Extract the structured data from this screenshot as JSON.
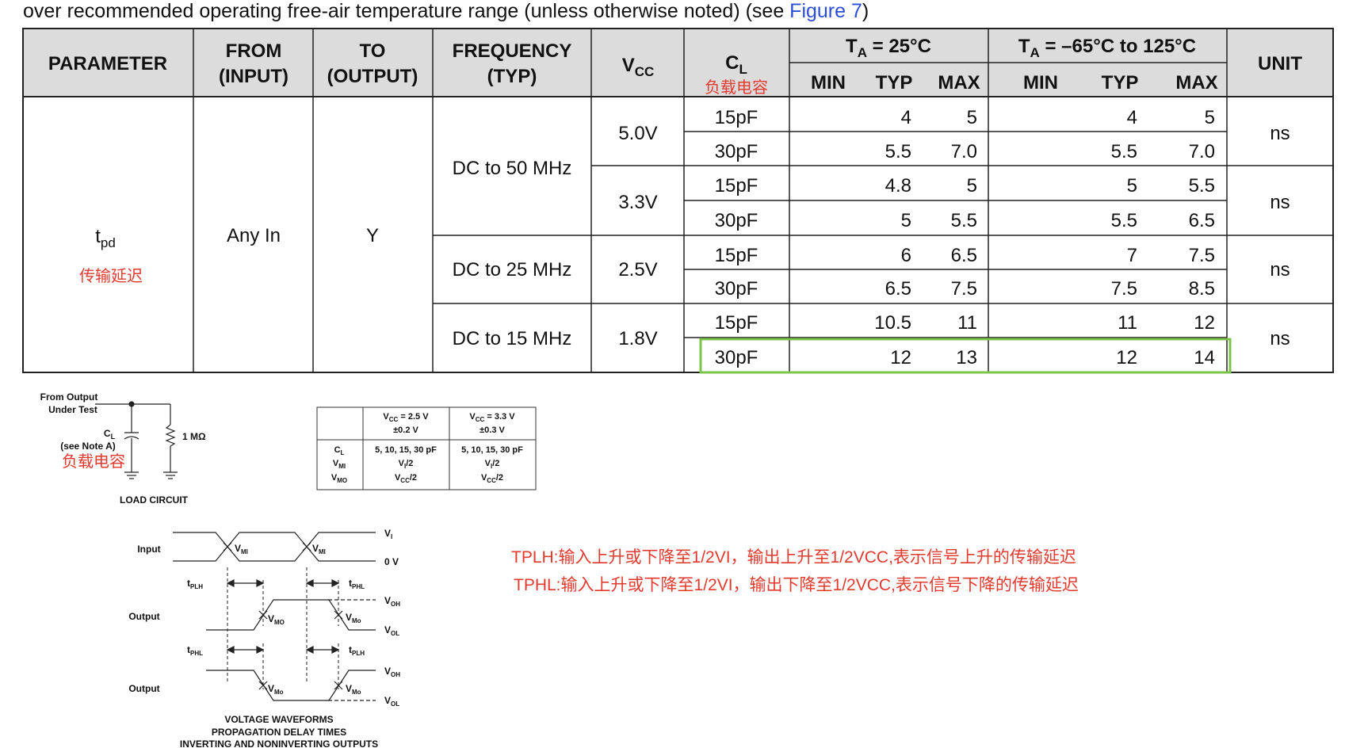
{
  "caption": {
    "text": "over recommended operating free-air temperature range (unless otherwise noted) (see ",
    "link": "Figure 7",
    "tail": ")"
  },
  "table": {
    "headers": {
      "parameter": "PARAMETER",
      "from_1": "FROM",
      "from_2": "(INPUT)",
      "to_1": "TO",
      "to_2": "(OUTPUT)",
      "freq_1": "FREQUENCY",
      "freq_2": "(TYP)",
      "vcc": "V",
      "vcc_sub": "CC",
      "cl": "C",
      "cl_sub": "L",
      "cl_note": "负载电容",
      "ta25": "T",
      "ta25_sub": "A",
      "ta25_tail": " = 25°C",
      "tarange": "T",
      "tarange_sub": "A",
      "tarange_tail": " = –65°C to 125°C",
      "min": "MIN",
      "typ": "TYP",
      "max": "MAX",
      "unit": "UNIT"
    },
    "parameter": "t",
    "parameter_sub": "pd",
    "parameter_note": "传输延迟",
    "from": "Any In",
    "to": "Y",
    "freqs": [
      "DC to 50 MHz",
      "DC to 25 MHz",
      "DC to 15 MHz"
    ],
    "vccs": [
      "5.0V",
      "3.3V",
      "2.5V",
      "1.8V"
    ],
    "units": [
      "ns",
      "ns",
      "ns",
      "ns"
    ],
    "rows": [
      {
        "cl": "15pF",
        "typ25": "4",
        "max25": "5",
        "typR": "4",
        "maxR": "5"
      },
      {
        "cl": "30pF",
        "typ25": "5.5",
        "max25": "7.0",
        "typR": "5.5",
        "maxR": "7.0"
      },
      {
        "cl": "15pF",
        "typ25": "4.8",
        "max25": "5",
        "typR": "5",
        "maxR": "5.5"
      },
      {
        "cl": "30pF",
        "typ25": "5",
        "max25": "5.5",
        "typR": "5.5",
        "maxR": "6.5"
      },
      {
        "cl": "15pF",
        "typ25": "6",
        "max25": "6.5",
        "typR": "7",
        "maxR": "7.5"
      },
      {
        "cl": "30pF",
        "typ25": "6.5",
        "max25": "7.5",
        "typR": "7.5",
        "maxR": "8.5"
      },
      {
        "cl": "15pF",
        "typ25": "10.5",
        "max25": "11",
        "typR": "11",
        "maxR": "12"
      },
      {
        "cl": "30pF",
        "typ25": "12",
        "max25": "13",
        "typR": "12",
        "maxR": "14"
      }
    ],
    "highlight_color": "#7dc34a"
  },
  "load_circuit": {
    "from_1": "From Output",
    "from_2": "Under Test",
    "cl": "C",
    "cl_sub": "L",
    "note": "(see Note A)",
    "note_cn": "负载电容",
    "res": "1 MΩ",
    "title": "LOAD CIRCUIT"
  },
  "mini_table": {
    "col1_a": "V",
    "col1_a_sub": "CC",
    "col1_a_tail": " = 2.5 V",
    "col1_b": "±0.2 V",
    "col2_a": "V",
    "col2_a_sub": "CC",
    "col2_a_tail": " = 3.3 V",
    "col2_b": "±0.3 V",
    "r1": "C",
    "r1_sub": "L",
    "r2": "V",
    "r2_sub": "MI",
    "r3": "V",
    "r3_sub": "MO",
    "v1": "5, 10, 15, 30 pF",
    "v2a": "V",
    "v2a_sub": "I",
    "v2a_tail": "/2",
    "v3a": "V",
    "v3a_sub": "CC",
    "v3a_tail": "/2"
  },
  "waveforms": {
    "input": "Input",
    "output": "Output",
    "vi": "V",
    "vi_sub": "I",
    "zero": "0 V",
    "vmi": "V",
    "vmi_sub": "MI",
    "vmo": "V",
    "vmo_sub": "MO",
    "vmo2_sub": "Mo",
    "voh": "V",
    "voh_sub": "OH",
    "vol": "V",
    "vol_sub": "OL",
    "tplh": "t",
    "tplh_sub": "PLH",
    "tphl": "t",
    "tphl_sub": "PHL",
    "title_1": "VOLTAGE WAVEFORMS",
    "title_2": "PROPAGATION DELAY TIMES",
    "title_3": "INVERTING AND NONINVERTING OUTPUTS"
  },
  "notes": {
    "line1": "TPLH:输入上升或下降至1/2VI，输出上升至1/2VCC,表示信号上升的传输延迟",
    "line2": "TPHL:输入上升或下降至1/2VI，输出下降至1/2VCC,表示信号下降的传输延迟",
    "color": "#e23a2e"
  }
}
